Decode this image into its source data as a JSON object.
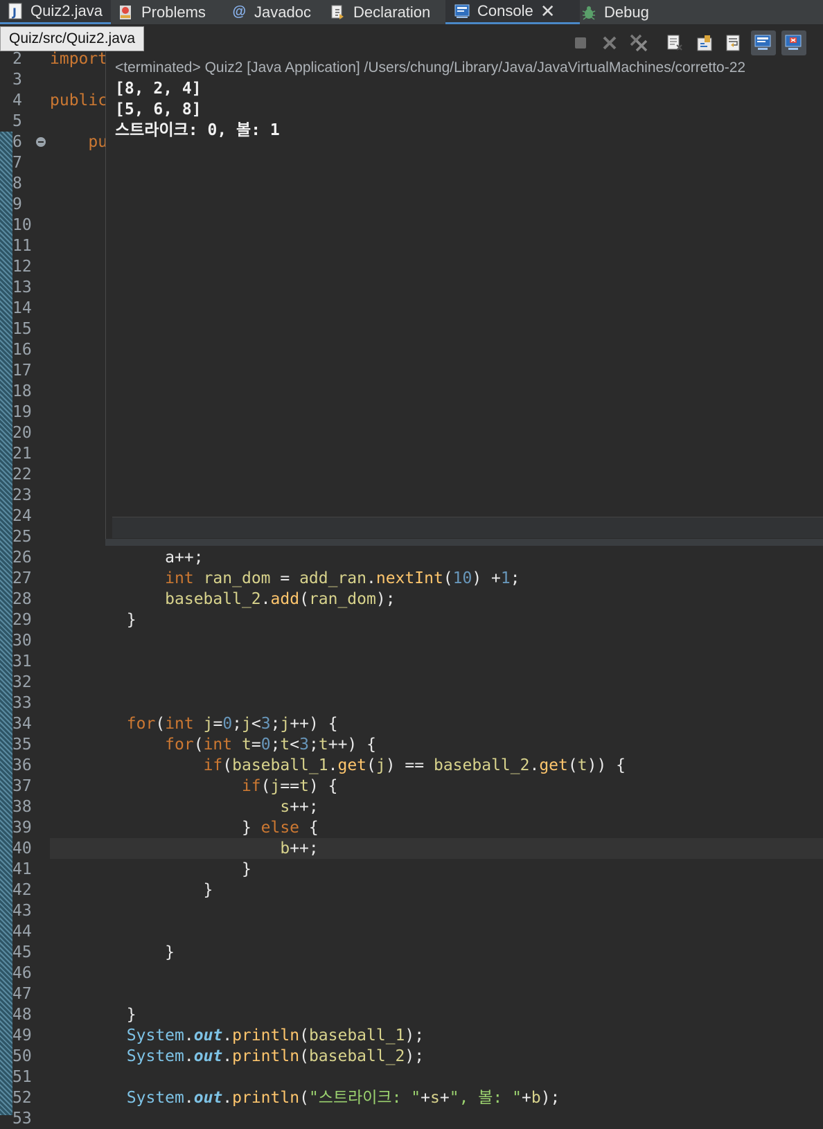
{
  "tabs": [
    {
      "label": "Quiz2.java",
      "icon": "java-file-icon"
    },
    {
      "label": "Problems",
      "icon": "problems-icon"
    },
    {
      "label": "Javadoc",
      "icon": "javadoc-icon"
    },
    {
      "label": "Declaration",
      "icon": "declaration-icon"
    },
    {
      "label": "Console",
      "icon": "console-icon",
      "close": "✕"
    },
    {
      "label": "Debug",
      "icon": "debug-bug-icon"
    }
  ],
  "tooltip": "Quiz/src/Quiz2.java",
  "console": {
    "header": "<terminated> Quiz2 [Java Application] /Users/chung/Library/Java/JavaVirtualMachines/corretto-22",
    "output": [
      "[8, 2, 4]",
      "[5, 6, 8]",
      "스트라이크: 0, 볼: 1"
    ],
    "toolbar_icons": [
      "terminate-icon",
      "remove-launch-icon",
      "remove-all-terminated-icon",
      "clear-console-icon",
      "scroll-lock-icon",
      "word-wrap-icon",
      "show-on-output-icon",
      "pin-console-icon"
    ]
  },
  "editor": {
    "line_numbers": [
      "2",
      "3",
      "4",
      "5",
      "6",
      "7",
      "8",
      "9",
      "10",
      "11",
      "12",
      "13",
      "14",
      "15",
      "16",
      "17",
      "18",
      "19",
      "20",
      "21",
      "22",
      "23",
      "24",
      "25",
      "26",
      "27",
      "28",
      "29",
      "30",
      "31",
      "32",
      "33",
      "34",
      "35",
      "36",
      "37",
      "38",
      "39",
      "40",
      "41",
      "42",
      "43",
      "44",
      "45",
      "46",
      "47",
      "48",
      "49",
      "50",
      "51",
      "52",
      "53"
    ],
    "visible_fragments": {
      "line2": "import",
      "line4": "public",
      "line6": "pu"
    },
    "code": {
      "l26": "a++;",
      "l27_kw": "int",
      "l27_var": "ran_dom",
      "l27_obj": "add_ran",
      "l27_fn": "nextInt",
      "l27_num": "10",
      "l27_num2": "1",
      "l28_obj": "baseball_2",
      "l28_fn": "add",
      "l28_arg": "ran_dom",
      "l29": "}",
      "l34_kw": "for",
      "l34_kw2": "int",
      "l34_rest": "j=0;j<3;j++",
      "l35_kw": "for",
      "l35_kw2": "int",
      "l35_rest": "t=0;t<3;t++",
      "l36_kw": "if",
      "l36_a": "baseball_1",
      "l36_get": "get",
      "l36_j": "j",
      "l36_b": "baseball_2",
      "l36_t": "t",
      "l37_kw": "if",
      "l37_cond": "j==t",
      "l38": "s++;",
      "l39_kw": "else",
      "l40": "b++;",
      "l41": "}",
      "l42": "}",
      "l45": "}",
      "l48": "}",
      "l49_sys": "System",
      "l49_out": "out",
      "l49_fn": "println",
      "l49_arg": "baseball_1",
      "l50_sys": "System",
      "l50_out": "out",
      "l50_fn": "println",
      "l50_arg": "baseball_2",
      "l52_sys": "System",
      "l52_out": "out",
      "l52_fn": "println",
      "l52_str1": "\"스트라이크: \"",
      "l52_s": "s",
      "l52_str2": "\", 볼: \"",
      "l52_b": "b"
    }
  }
}
